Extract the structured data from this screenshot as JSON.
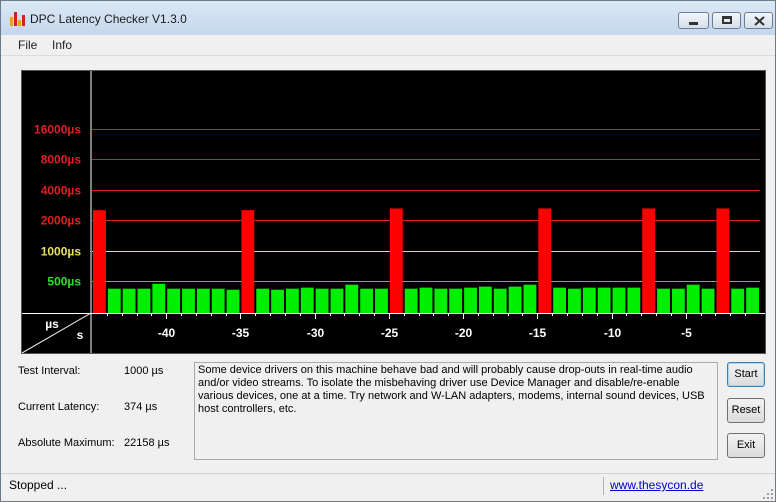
{
  "window": {
    "title": "DPC Latency Checker V1.3.0"
  },
  "menu": {
    "items": [
      "File",
      "Info"
    ]
  },
  "chart_data": {
    "type": "bar",
    "y_scale": "log",
    "y_tick_labels": [
      {
        "label": "16000µs",
        "value": 16000,
        "color": "#e02020"
      },
      {
        "label": "8000µs",
        "value": 8000,
        "color": "#e02020"
      },
      {
        "label": "4000µs",
        "value": 4000,
        "color": "#e02020"
      },
      {
        "label": "2000µs",
        "value": 2000,
        "color": "#e02020"
      },
      {
        "label": "1000µs",
        "value": 1000,
        "color": "#e8e060"
      },
      {
        "label": "500µs",
        "value": 500,
        "color": "#30e030"
      }
    ],
    "x_tick_labels": [
      "-40",
      "-35",
      "-30",
      "-25",
      "-20",
      "-15",
      "-10",
      "-5"
    ],
    "x_ticks": [
      -40,
      -35,
      -30,
      -25,
      -20,
      -15,
      -10,
      -5
    ],
    "x_range": [
      -45,
      0
    ],
    "corner_labels": {
      "y": "µs",
      "x": "s"
    },
    "bar_colors": {
      "red": "#ff0000",
      "green": "#00ee00"
    },
    "bars": [
      {
        "x": -44.5,
        "value": 2500,
        "status": "red"
      },
      {
        "x": -43.5,
        "value": 420,
        "status": "green"
      },
      {
        "x": -42.5,
        "value": 420,
        "status": "green"
      },
      {
        "x": -41.5,
        "value": 420,
        "status": "green"
      },
      {
        "x": -40.5,
        "value": 470,
        "status": "green"
      },
      {
        "x": -39.5,
        "value": 420,
        "status": "green"
      },
      {
        "x": -38.5,
        "value": 420,
        "status": "green"
      },
      {
        "x": -37.5,
        "value": 420,
        "status": "green"
      },
      {
        "x": -36.5,
        "value": 420,
        "status": "green"
      },
      {
        "x": -35.5,
        "value": 410,
        "status": "green"
      },
      {
        "x": -34.5,
        "value": 2500,
        "status": "red"
      },
      {
        "x": -33.5,
        "value": 420,
        "status": "green"
      },
      {
        "x": -32.5,
        "value": 410,
        "status": "green"
      },
      {
        "x": -31.5,
        "value": 420,
        "status": "green"
      },
      {
        "x": -30.5,
        "value": 430,
        "status": "green"
      },
      {
        "x": -29.5,
        "value": 420,
        "status": "green"
      },
      {
        "x": -28.5,
        "value": 420,
        "status": "green"
      },
      {
        "x": -27.5,
        "value": 460,
        "status": "green"
      },
      {
        "x": -26.5,
        "value": 420,
        "status": "green"
      },
      {
        "x": -25.5,
        "value": 420,
        "status": "green"
      },
      {
        "x": -24.5,
        "value": 2600,
        "status": "red"
      },
      {
        "x": -23.5,
        "value": 420,
        "status": "green"
      },
      {
        "x": -22.5,
        "value": 430,
        "status": "green"
      },
      {
        "x": -21.5,
        "value": 420,
        "status": "green"
      },
      {
        "x": -20.5,
        "value": 420,
        "status": "green"
      },
      {
        "x": -19.5,
        "value": 430,
        "status": "green"
      },
      {
        "x": -18.5,
        "value": 440,
        "status": "green"
      },
      {
        "x": -17.5,
        "value": 420,
        "status": "green"
      },
      {
        "x": -16.5,
        "value": 440,
        "status": "green"
      },
      {
        "x": -15.5,
        "value": 460,
        "status": "green"
      },
      {
        "x": -14.5,
        "value": 2600,
        "status": "red"
      },
      {
        "x": -13.5,
        "value": 430,
        "status": "green"
      },
      {
        "x": -12.5,
        "value": 420,
        "status": "green"
      },
      {
        "x": -11.5,
        "value": 430,
        "status": "green"
      },
      {
        "x": -10.5,
        "value": 430,
        "status": "green"
      },
      {
        "x": -9.5,
        "value": 430,
        "status": "green"
      },
      {
        "x": -8.5,
        "value": 430,
        "status": "green"
      },
      {
        "x": -7.5,
        "value": 2600,
        "status": "red"
      },
      {
        "x": -6.5,
        "value": 420,
        "status": "green"
      },
      {
        "x": -5.5,
        "value": 420,
        "status": "green"
      },
      {
        "x": -4.5,
        "value": 460,
        "status": "green"
      },
      {
        "x": -3.5,
        "value": 420,
        "status": "green"
      },
      {
        "x": -2.5,
        "value": 2600,
        "status": "red"
      },
      {
        "x": -1.5,
        "value": 420,
        "status": "green"
      },
      {
        "x": -0.5,
        "value": 430,
        "status": "green"
      }
    ]
  },
  "info": {
    "test_interval_label": "Test Interval:",
    "test_interval_value": "1000 µs",
    "current_latency_label": "Current Latency:",
    "current_latency_value": "374 µs",
    "absolute_max_label": "Absolute Maximum:",
    "absolute_max_value": "22158 µs"
  },
  "message": "Some device drivers on this machine behave bad and will probably cause drop-outs in real-time audio and/or video streams. To isolate the misbehaving driver use Device Manager and disable/re-enable various devices, one at a time. Try network and W-LAN adapters, modems, internal sound devices, USB host controllers, etc.",
  "buttons": {
    "start": "Start",
    "reset": "Reset",
    "exit": "Exit"
  },
  "status": {
    "text": "Stopped ...",
    "link": "www.thesycon.de"
  }
}
